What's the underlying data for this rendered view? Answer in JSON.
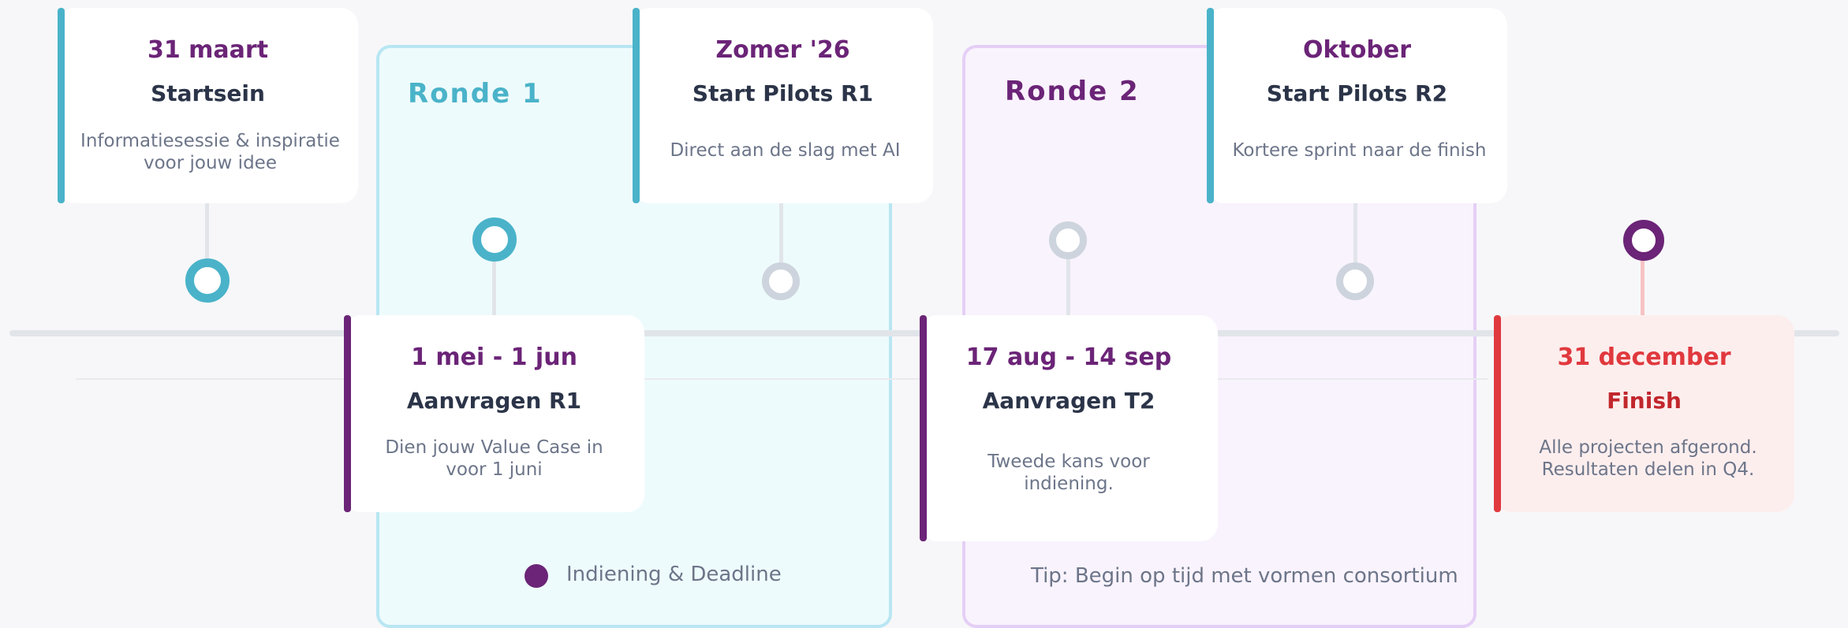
{
  "rounds": [
    {
      "label": "Ronde 1"
    },
    {
      "label": "Ronde 2"
    }
  ],
  "milestones": [
    {
      "date": "31 maart",
      "title": "Startsein",
      "description": "Informatiesessie & inspiratie voor jouw idee"
    },
    {
      "date": "1 mei - 1 jun",
      "title": "Aanvragen R1",
      "description": "Dien jouw Value Case in voor 1 juni"
    },
    {
      "date": "Zomer '26",
      "title": "Start Pilots R1",
      "description": "Direct aan de slag met AI"
    },
    {
      "date": "17 aug - 14 sep",
      "title": "Aanvragen T2",
      "description": "Tweede kans voor indiening."
    },
    {
      "date": "Oktober",
      "title": "Start Pilots R2",
      "description": "Kortere sprint naar de finish"
    },
    {
      "date": "31 december",
      "title": "Finish",
      "description": "Alle projecten afgerond. Resultaten delen in Q4."
    }
  ],
  "legend": {
    "label": "Indiening & Deadline"
  },
  "tip": "Tip: Begin op tijd met vormen consortium",
  "colors": {
    "teal": "#4ab3c9",
    "purple": "#6b2477",
    "red": "#e0393e",
    "grey_marker": "#cdd4dd",
    "axis": "#e1e5ea"
  }
}
